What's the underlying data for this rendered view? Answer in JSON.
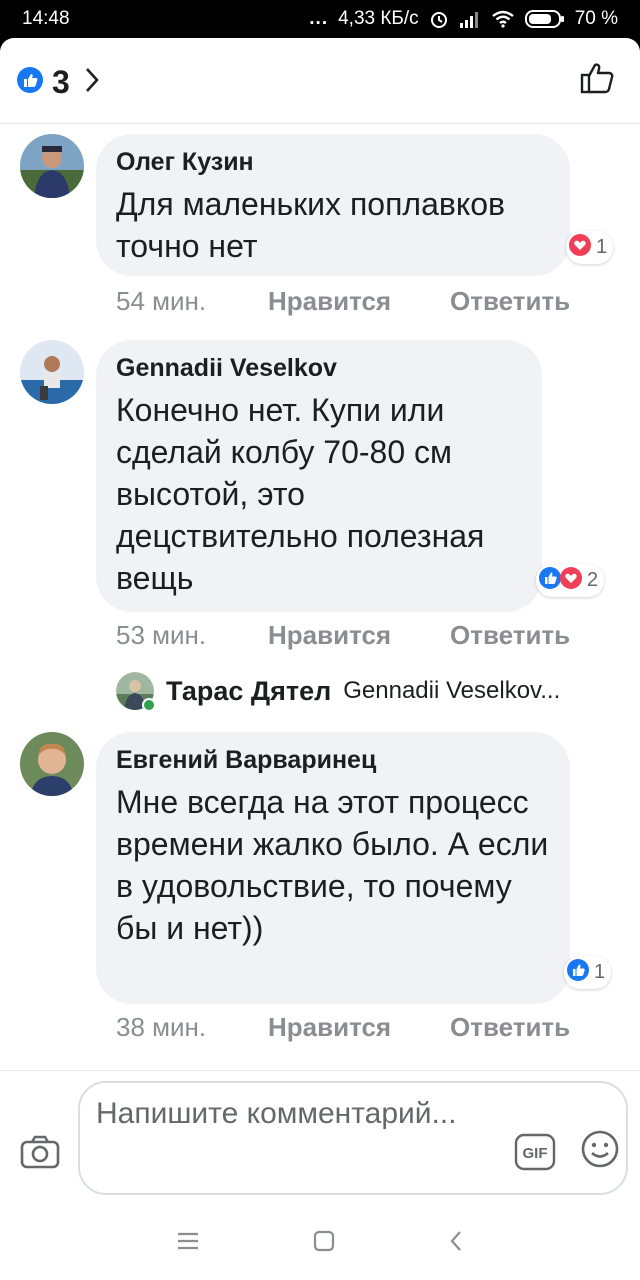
{
  "status_bar": {
    "time": "14:48",
    "dots": "...",
    "speed": "4,33 КБ/с",
    "battery": "70 %"
  },
  "header": {
    "like_count": "3",
    "icons": [
      "like-reaction-icon",
      "chevron-right-icon",
      "thumbs-up-outline-icon"
    ]
  },
  "comments": [
    {
      "author": "Олег Кузин",
      "text": "Для маленьких поплавков точно нет",
      "reaction_count": "1",
      "reactions": [
        "love"
      ],
      "time": "54 мин.",
      "like_label": "Нравится",
      "reply_label": "Ответить"
    },
    {
      "author": "Gennadii Veselkov",
      "text": "Конечно нет. Купи или сделай колбу 70-80 см высотой, это децствительно полезная вещь",
      "reaction_count": "2",
      "reactions": [
        "like",
        "love"
      ],
      "time": "53 мин.",
      "like_label": "Нравится",
      "reply_label": "Ответить"
    },
    {
      "author": "Евгений Варваринец",
      "text": "Мне всегда на этот процесс времени жалко было. А если в удовольствие, то почему бы и нет))",
      "reaction_count": "1",
      "reactions": [
        "like"
      ],
      "time": "38 мин.",
      "like_label": "Нравится",
      "reply_label": "Ответить"
    }
  ],
  "reply_preview": {
    "author": "Тарас Дятел",
    "text": "Gennadii Veselkov..."
  },
  "composer": {
    "placeholder": "Напишите комментарий...",
    "gif_label": "GIF"
  },
  "colors": {
    "like_blue": "#1877f2",
    "love_red": "#f33e58",
    "bubble_bg": "#f0f2f5",
    "online_green": "#31a24c"
  }
}
